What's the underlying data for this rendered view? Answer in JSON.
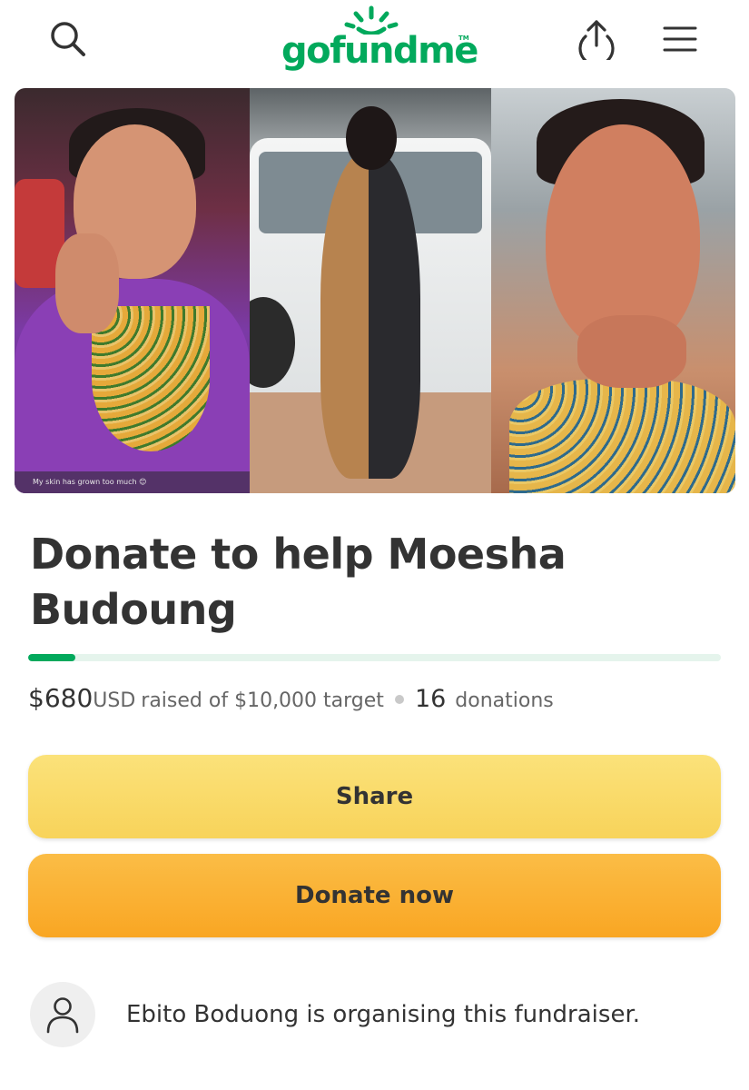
{
  "header": {
    "logo_text": "gofundme",
    "logo_tm": "TM",
    "icons": {
      "search": "search-icon",
      "share": "upload-share-icon",
      "menu": "hamburger-menu-icon"
    },
    "brand_color": "#02a95c"
  },
  "hero": {
    "caption": "My skin has grown too much 😊"
  },
  "campaign": {
    "title": "Donate to help Moesha Budoung",
    "progress_fraction": 0.068,
    "raised_amount": "$680",
    "raised_currency": "USD",
    "raised_text": "raised of $10,000 target",
    "donations_count": "16",
    "donations_label": "donations"
  },
  "actions": {
    "share_label": "Share",
    "donate_label": "Donate now",
    "share_color": "#f9d85f",
    "donate_color": "#faae2e"
  },
  "organiser": {
    "text": "Ebito Boduong is organising this fundraiser.",
    "avatar_icon": "user-icon"
  }
}
